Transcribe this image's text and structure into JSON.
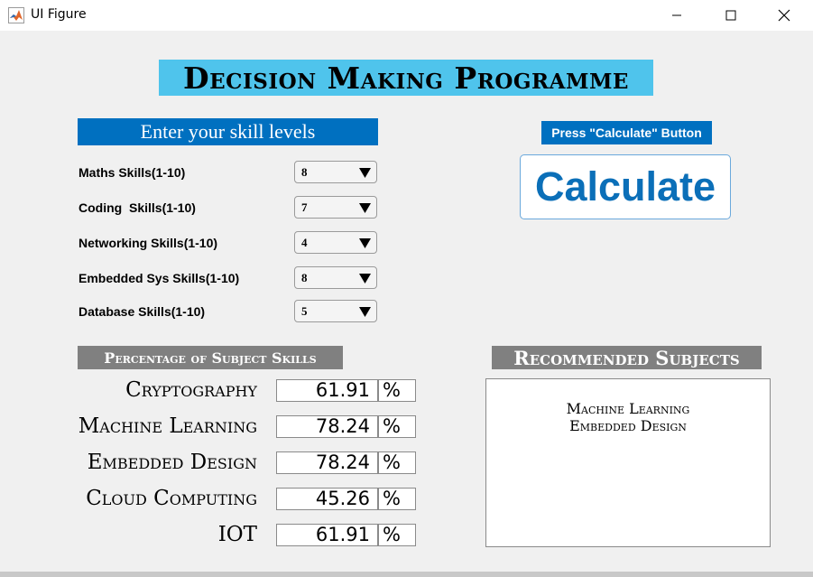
{
  "window": {
    "title": "UI Figure"
  },
  "main_title": "Decision Making Programme",
  "skills_header": "Enter your skill levels",
  "skills": [
    {
      "label": "Maths Skills(1-10)",
      "value": "8"
    },
    {
      "label": "Coding  Skills(1-10)",
      "value": "7"
    },
    {
      "label": "Networking Skills(1-10)",
      "value": "4"
    },
    {
      "label": "Embedded Sys Skills(1-10)",
      "value": "8"
    },
    {
      "label": "Database Skills(1-10)",
      "value": "5"
    }
  ],
  "calc_header": "Press \"Calculate\" Button",
  "calc_button": "Calculate",
  "percentage_header": "Percentage of Subject Skills",
  "subjects": [
    {
      "name": "Cryptography",
      "value": "61.91",
      "unit": "%"
    },
    {
      "name": "Machine Learning",
      "value": "78.24",
      "unit": "%"
    },
    {
      "name": "Embedded Design",
      "value": "78.24",
      "unit": "%"
    },
    {
      "name": "Cloud Computing",
      "value": "45.26",
      "unit": "%"
    },
    {
      "name": "IOT",
      "value": "61.91",
      "unit": "%"
    }
  ],
  "recommended_header": "Recommended Subjects",
  "recommended": [
    "Machine Learning",
    "Embedded Design"
  ],
  "colors": {
    "title_bg": "#4fc4ec",
    "header_blue": "#0070c0",
    "header_gray": "#808080",
    "calc_text": "#0b6fb8"
  }
}
